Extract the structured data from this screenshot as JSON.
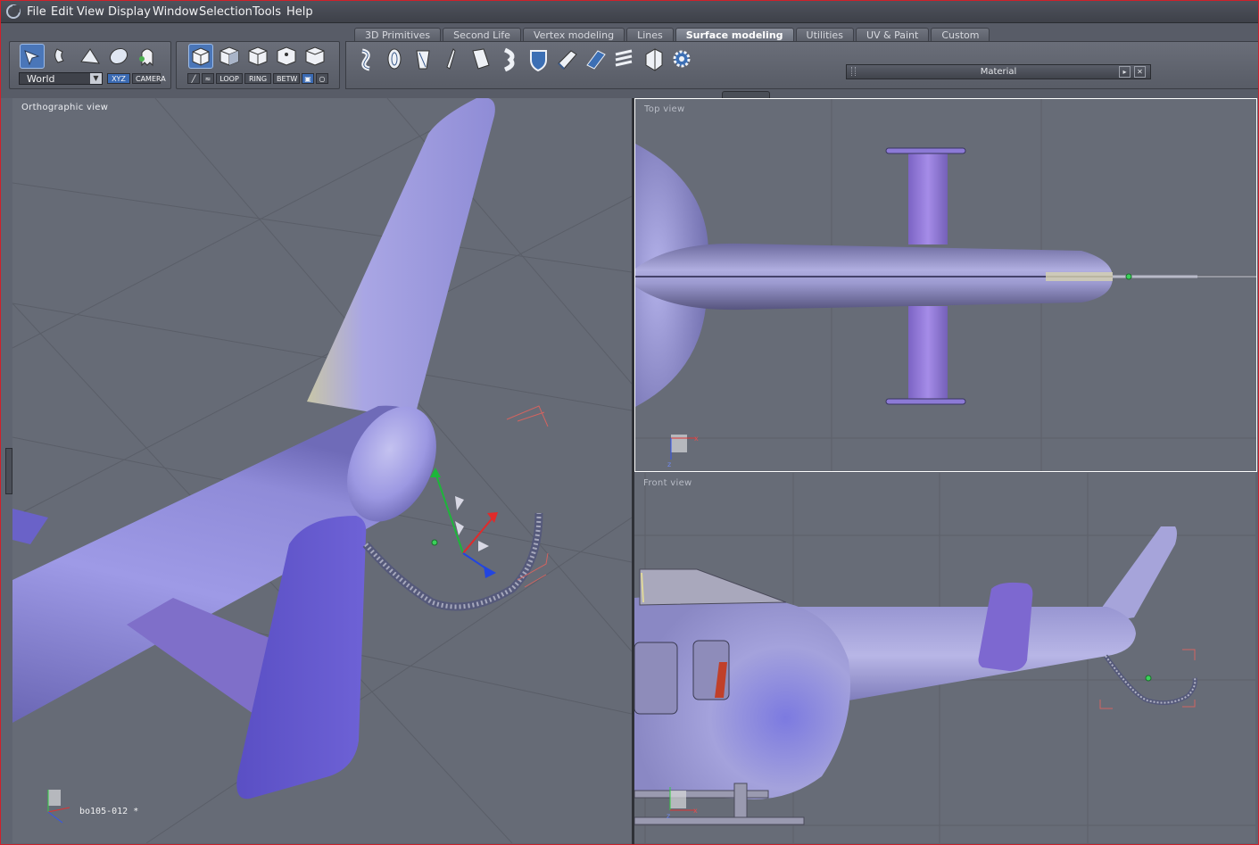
{
  "menu": [
    "File",
    "Edit",
    "View",
    "Display",
    "Window",
    "Selection",
    "Tools",
    "Help"
  ],
  "tabs": [
    {
      "label": "3D Primitives",
      "active": false
    },
    {
      "label": "Second Life",
      "active": false
    },
    {
      "label": "Vertex modeling",
      "active": false
    },
    {
      "label": "Lines",
      "active": false
    },
    {
      "label": "Surface modeling",
      "active": true
    },
    {
      "label": "Utilities",
      "active": false
    },
    {
      "label": "UV & Paint",
      "active": false
    },
    {
      "label": "Custom",
      "active": false
    }
  ],
  "toolbar": {
    "coord_space": "World",
    "xyz_label": "XYZ",
    "camera_label": "CAMERA",
    "loop_label": "LOOP",
    "ring_label": "RING",
    "betw_label": "BETW"
  },
  "material_panel": {
    "title": "Material"
  },
  "viewports": {
    "perspective": {
      "label": "Orthographic view",
      "object_name": "bo105-012 *"
    },
    "top": {
      "label": "Top view"
    },
    "front": {
      "label": "Front view"
    }
  },
  "colors": {
    "accent": "#4a76b8",
    "mesh": "#8a86d8",
    "frame": "#d0202a"
  }
}
